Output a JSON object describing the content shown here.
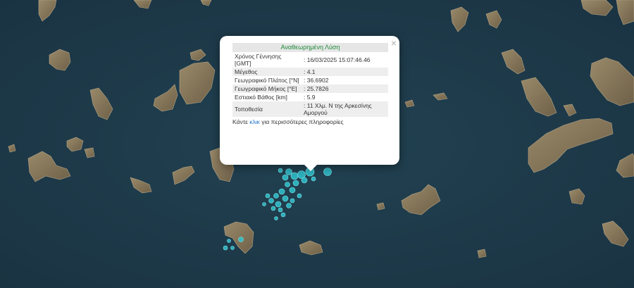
{
  "popup": {
    "title": "Αναθεωρημένη Λύση",
    "rows": [
      {
        "label": "Χρόνος Γέννησης [GMT]",
        "value": ": 16/03/2025 15:07:46.46"
      },
      {
        "label": "Μέγεθος",
        "value": ": 4.1"
      },
      {
        "label": "Γεωγραφικό Πλάτος [°N]",
        "value": ": 36.6902"
      },
      {
        "label": "Γεωγραφικό Μήκος [°E]",
        "value": ": 25.7826"
      },
      {
        "label": "Εστιακό Βάθος [km]",
        "value": ": 5.9"
      },
      {
        "label": "Τοποθεσία",
        "value": ": 11 Χλμ. N της Αρκεσίνης Αμοργού"
      }
    ],
    "more_prefix": "Κάντε ",
    "more_link": "κλικ",
    "more_suffix": " για περισσότερες πληροφορίες",
    "close": "×"
  },
  "colors": {
    "sea": "#1e3a4a",
    "land": "#8a7a5c",
    "marker": "#2fc4cf",
    "popup_title": "#1f8a3a",
    "link": "#1a73c8"
  }
}
